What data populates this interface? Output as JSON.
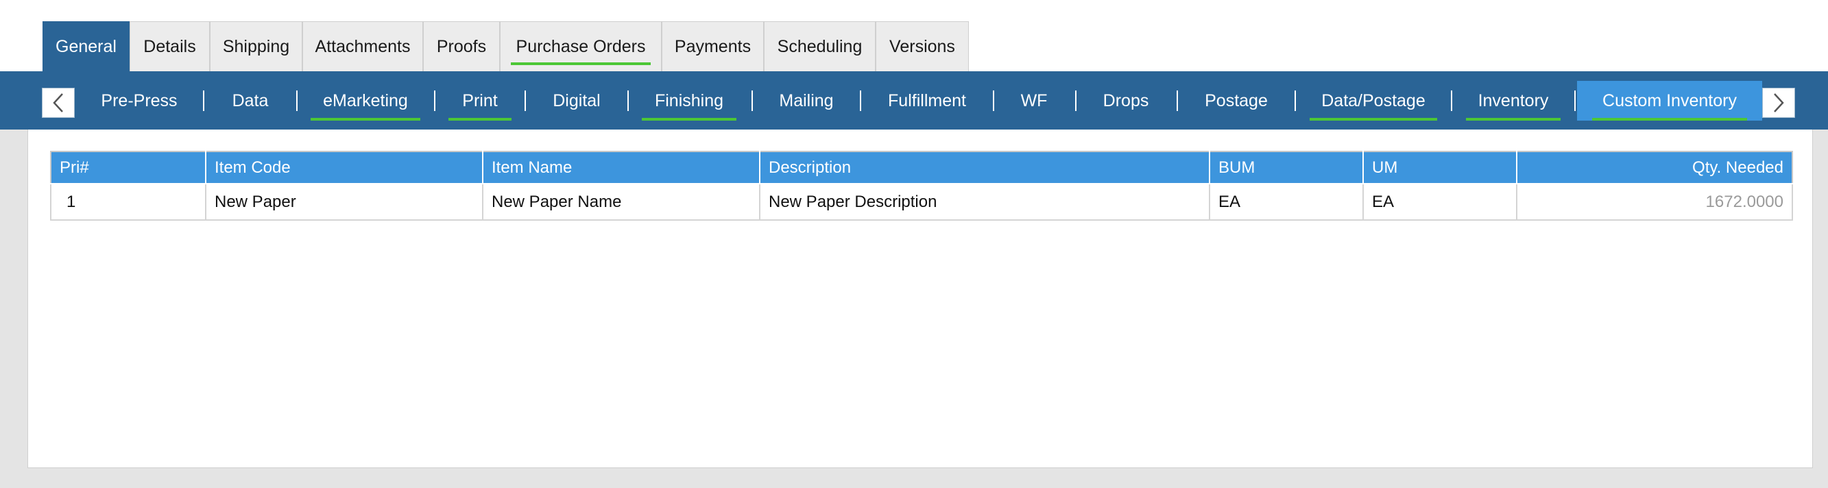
{
  "top_tabs": [
    {
      "label": "General",
      "active": true,
      "underline": false
    },
    {
      "label": "Details",
      "active": false,
      "underline": false
    },
    {
      "label": "Shipping",
      "active": false,
      "underline": false
    },
    {
      "label": "Attachments",
      "active": false,
      "underline": false
    },
    {
      "label": "Proofs",
      "active": false,
      "underline": false
    },
    {
      "label": "Purchase Orders",
      "active": false,
      "underline": true
    },
    {
      "label": "Payments",
      "active": false,
      "underline": false
    },
    {
      "label": "Scheduling",
      "active": false,
      "underline": false
    },
    {
      "label": "Versions",
      "active": false,
      "underline": false
    }
  ],
  "sub_tabs": [
    {
      "label": "Pre-Press",
      "active": false,
      "underline": false
    },
    {
      "label": "Data",
      "active": false,
      "underline": false
    },
    {
      "label": "eMarketing",
      "active": false,
      "underline": true
    },
    {
      "label": "Print",
      "active": false,
      "underline": true
    },
    {
      "label": "Digital",
      "active": false,
      "underline": false
    },
    {
      "label": "Finishing",
      "active": false,
      "underline": true
    },
    {
      "label": "Mailing",
      "active": false,
      "underline": false
    },
    {
      "label": "Fulfillment",
      "active": false,
      "underline": false
    },
    {
      "label": "WF",
      "active": false,
      "underline": false
    },
    {
      "label": "Drops",
      "active": false,
      "underline": false
    },
    {
      "label": "Postage",
      "active": false,
      "underline": false
    },
    {
      "label": "Data/Postage",
      "active": false,
      "underline": true
    },
    {
      "label": "Inventory",
      "active": false,
      "underline": true
    },
    {
      "label": "Custom Inventory",
      "active": true,
      "underline": true
    }
  ],
  "nav_icons": {
    "prev": "chevron-left-icon",
    "next": "chevron-right-icon"
  },
  "table": {
    "columns": [
      "Pri#",
      "Item Code",
      "Item Name",
      "Description",
      "BUM",
      "UM",
      "Qty. Needed"
    ],
    "rows": [
      [
        "1",
        "New Paper",
        "New Paper Name",
        "New Paper Description",
        "EA",
        "EA",
        "1672.0000"
      ]
    ]
  },
  "colors": {
    "nav_blue": "#2a6496",
    "active_blue": "#3d95dd",
    "underline_green": "#4cc736"
  }
}
